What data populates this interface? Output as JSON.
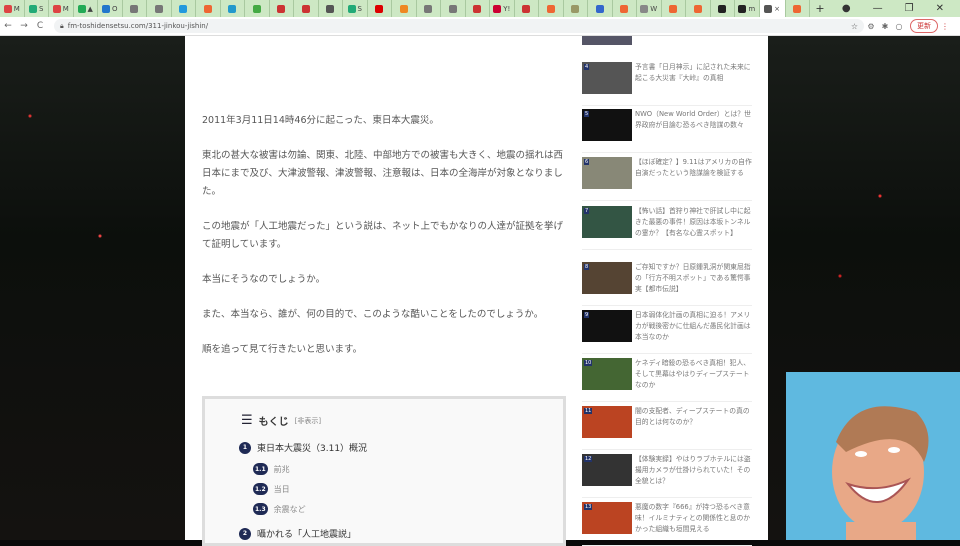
{
  "browser": {
    "tabs": [
      {
        "label": "M",
        "color": "#d44"
      },
      {
        "label": "S",
        "color": "#2a7"
      },
      {
        "label": "M",
        "color": "#d44"
      },
      {
        "label": "▲",
        "color": "#2a5"
      },
      {
        "label": "O",
        "color": "#27c"
      },
      {
        "label": "",
        "color": "#777"
      },
      {
        "label": "",
        "color": "#777"
      },
      {
        "label": "",
        "color": "#29d"
      },
      {
        "label": "",
        "color": "#e63"
      },
      {
        "label": "",
        "color": "#29c"
      },
      {
        "label": "",
        "color": "#4a4"
      },
      {
        "label": "",
        "color": "#c33"
      },
      {
        "label": "",
        "color": "#c33"
      },
      {
        "label": "",
        "color": "#555"
      },
      {
        "label": "S",
        "color": "#2a7"
      },
      {
        "label": "",
        "color": "#d00"
      },
      {
        "label": "",
        "color": "#e82"
      },
      {
        "label": "",
        "color": "#777"
      },
      {
        "label": "",
        "color": "#777"
      },
      {
        "label": "",
        "color": "#c33"
      },
      {
        "label": "Y!",
        "color": "#c03"
      },
      {
        "label": "",
        "color": "#c33"
      },
      {
        "label": "",
        "color": "#e63"
      },
      {
        "label": "",
        "color": "#996"
      },
      {
        "label": "",
        "color": "#36c"
      },
      {
        "label": "",
        "color": "#e63"
      },
      {
        "label": "W",
        "color": "#888"
      },
      {
        "label": "",
        "color": "#e63"
      },
      {
        "label": "",
        "color": "#e63"
      },
      {
        "label": "",
        "color": "#222"
      },
      {
        "label": "m",
        "color": "#222"
      },
      {
        "label": "×",
        "color": "#555",
        "active": true
      },
      {
        "label": "",
        "color": "#e63"
      }
    ],
    "new_tab": "+",
    "url": "fm-toshidensetsu.com/311-jinkou-jishin/",
    "update_label": "更新"
  },
  "article": {
    "paragraphs": [
      "2011年3月11日14時46分に起こった、東日本大震災。",
      "東北の甚大な被害は勿論、関東、北陸、中部地方での被害も大きく、地震の揺れは西日本にまで及び、大津波警報、津波警報、注意報は、日本の全海岸が対象となりました。",
      "この地震が「人工地震だった」という説は、ネット上でもかなりの人達が証拠を挙げて証明しています。",
      "本当にそうなのでしょうか。",
      "また、本当なら、誰が、何の目的で、このような酷いことをしたのでしょうか。",
      "順を追って見て行きたいと思います。"
    ]
  },
  "toc": {
    "title": "もくじ",
    "toggle": "[非表示]",
    "items": [
      {
        "num": "1",
        "label": "東日本大震災（3.11）概況"
      },
      {
        "num": "1.1",
        "label": "前兆"
      },
      {
        "num": "1.2",
        "label": "当日"
      },
      {
        "num": "1.3",
        "label": "余震など"
      },
      {
        "num": "2",
        "label": "囁かれる「人工地震説」"
      }
    ]
  },
  "sidebar": {
    "items": [
      {
        "rank": "4",
        "title": "予言書「日月神示」に記された未来に起こる大災害『大峠』の真相"
      },
      {
        "rank": "5",
        "title": "NWO（New World Order）とは？世界政府が目論む恐るべき陰謀の数々"
      },
      {
        "rank": "6",
        "title": "【ほぼ確定？】9.11はアメリカの自作自演だったという陰謀論を検証する"
      },
      {
        "rank": "7",
        "title": "【怖い話】首狩り神社で肝試し中に起きた最悪の事件！原因は本坂トンネルの霊か？【有名な心霊スポット】"
      },
      {
        "rank": "8",
        "title": "ご存知ですか？日原鍾乳洞が関東屈指の「行方不明スポット」である驚愕事実【都市伝説】"
      },
      {
        "rank": "9",
        "title": "日本弱体化計画の真相に迫る！アメリカが戦後密かに仕組んだ愚民化計画は本当なのか"
      },
      {
        "rank": "10",
        "title": "ケネディ暗殺の恐るべき真相！犯人、そして黒幕はやはりディープステートなのか"
      },
      {
        "rank": "11",
        "title": "闇の支配者、ディープステートの真の目的とは何なのか？"
      },
      {
        "rank": "12",
        "title": "【体験実録】やはりラブホテルには盗撮用カメラが仕掛けられていた！その全貌とは？"
      },
      {
        "rank": "13",
        "title": "悪魔の数字『666』が持つ恐るべき意味！イルミナティとの関係性と息のかかった組織も垣間見える"
      }
    ]
  }
}
